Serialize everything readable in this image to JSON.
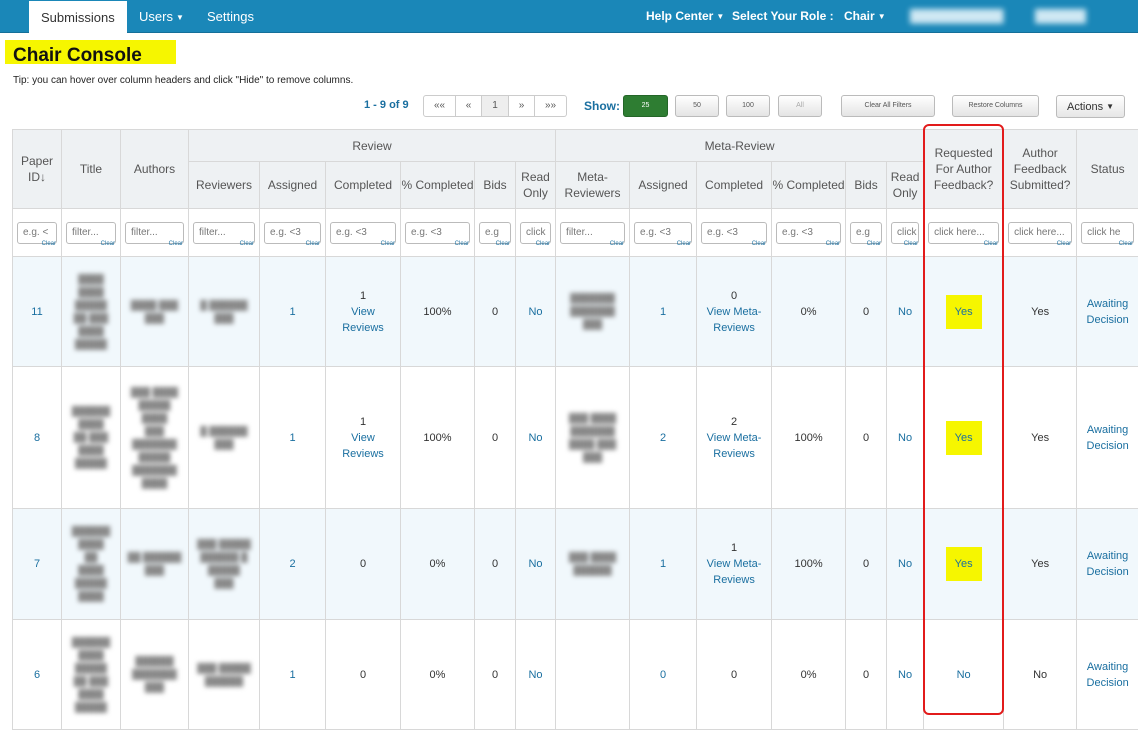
{
  "nav": {
    "tabs": [
      "Submissions",
      "Users",
      "Settings"
    ],
    "help": "Help Center",
    "role_label": "Select Your Role :",
    "role": "Chair"
  },
  "header": {
    "title": "Chair Console",
    "tip": "Tip: you can hover over column headers and click \"Hide\" to remove columns."
  },
  "pager": {
    "info": "1 - 9 of 9",
    "first": "««",
    "prev": "«",
    "page": "1",
    "next": "»",
    "last": "»»"
  },
  "show": {
    "label": "Show:",
    "options": [
      "25",
      "50",
      "100",
      "All"
    ]
  },
  "buttons": {
    "clear_filters": "Clear All Filters",
    "restore_columns": "Restore Columns",
    "actions": "Actions"
  },
  "table": {
    "group_review": "Review",
    "group_meta": "Meta-Review",
    "cols": {
      "paper_id": "Paper ID",
      "title": "Title",
      "authors": "Authors",
      "reviewers": "Reviewers",
      "assigned": "Assigned",
      "completed": "Completed",
      "pct_completed": "% Completed",
      "bids": "Bids",
      "read_only": "Read Only",
      "meta_reviewers": "Meta-Reviewers",
      "meta_assigned": "Assigned",
      "meta_completed": "Completed",
      "meta_pct": "% Completed",
      "meta_bids": "Bids",
      "meta_read_only": "Read Only",
      "requested_feedback": "Requested For Author Feedback?",
      "feedback_submitted": "Author Feedback Submitted?",
      "status": "Status"
    },
    "filters": {
      "paper_id": "e.g. <",
      "title": "filter...",
      "authors": "filter...",
      "reviewers": "filter...",
      "assigned": "e.g. <3",
      "completed": "e.g. <3",
      "pct_completed": "e.g. <3",
      "bids": "e.g",
      "read_only": "click",
      "meta_reviewers": "filter...",
      "meta_assigned": "e.g. <3",
      "meta_completed": "e.g. <3",
      "meta_pct": "e.g. <3",
      "meta_bids": "e.g",
      "meta_read_only": "click",
      "requested_feedback": "click here...",
      "feedback_submitted": "click here...",
      "status": "click he",
      "clear": "Clear"
    },
    "rows": [
      {
        "id": "11",
        "assigned": "1",
        "completed": "1",
        "completed_link": "View Reviews",
        "pct": "100%",
        "bids": "0",
        "read_only": "No",
        "meta_assigned": "1",
        "meta_completed": "0",
        "meta_completed_link": "View Meta-Reviews",
        "meta_pct": "0%",
        "meta_bids": "0",
        "meta_read_only": "No",
        "requested": "Yes",
        "submitted": "Yes",
        "status": "Awaiting Decision"
      },
      {
        "id": "8",
        "assigned": "1",
        "completed": "1",
        "completed_link": "View Reviews",
        "pct": "100%",
        "bids": "0",
        "read_only": "No",
        "meta_assigned": "2",
        "meta_completed": "2",
        "meta_completed_link": "View Meta-Reviews",
        "meta_pct": "100%",
        "meta_bids": "0",
        "meta_read_only": "No",
        "requested": "Yes",
        "submitted": "Yes",
        "status": "Awaiting Decision"
      },
      {
        "id": "7",
        "assigned": "2",
        "completed": "0",
        "completed_link": "",
        "pct": "0%",
        "bids": "0",
        "read_only": "No",
        "meta_assigned": "1",
        "meta_completed": "1",
        "meta_completed_link": "View Meta-Reviews",
        "meta_pct": "100%",
        "meta_bids": "0",
        "meta_read_only": "No",
        "requested": "Yes",
        "submitted": "Yes",
        "status": "Awaiting Decision"
      },
      {
        "id": "6",
        "assigned": "1",
        "completed": "0",
        "completed_link": "",
        "pct": "0%",
        "bids": "0",
        "read_only": "No",
        "meta_assigned": "0",
        "meta_completed": "0",
        "meta_completed_link": "",
        "meta_pct": "0%",
        "meta_bids": "0",
        "meta_read_only": "No",
        "requested": "No",
        "submitted": "No",
        "status": "Awaiting Decision"
      }
    ]
  },
  "colors": {
    "nav_bg": "#1a87b8",
    "highlight": "#f6f600",
    "annotation_border": "#e21b1b",
    "link": "#1a6fa0"
  }
}
